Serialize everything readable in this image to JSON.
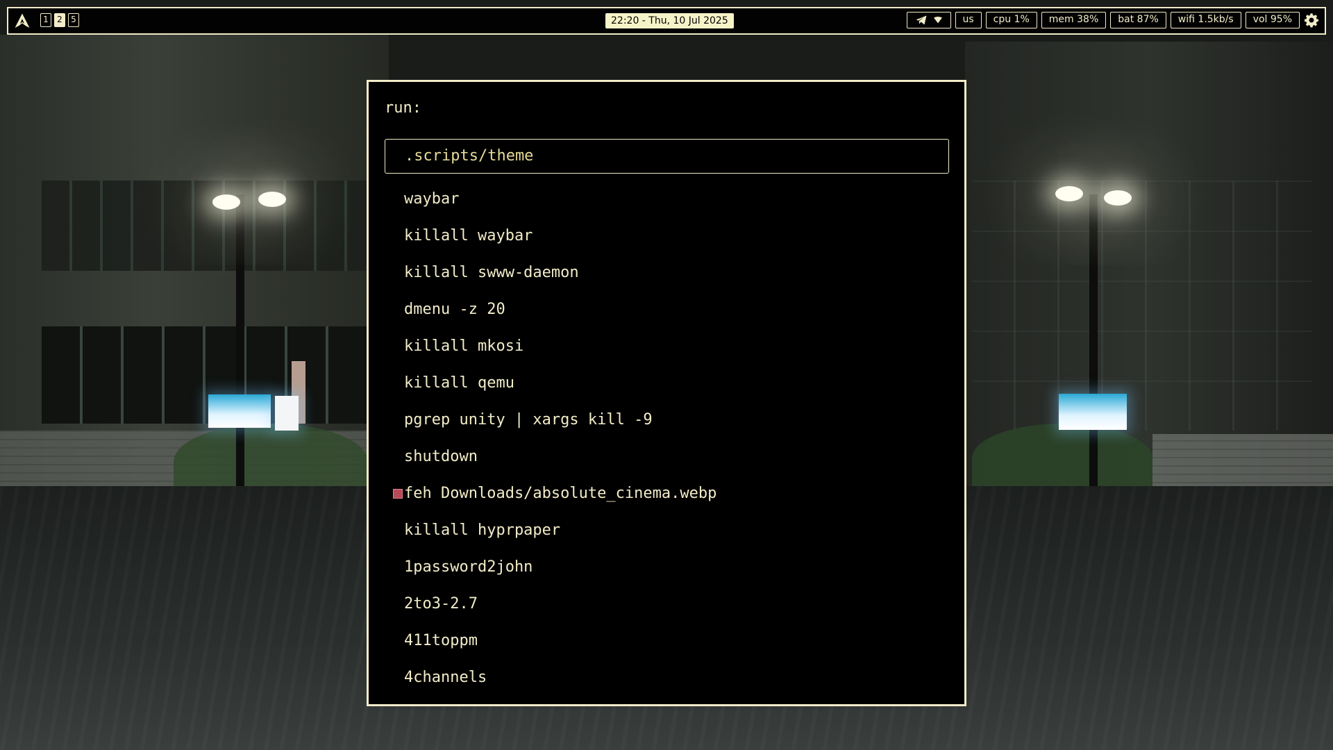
{
  "topbar": {
    "workspaces": [
      {
        "label": "1",
        "active": false
      },
      {
        "label": "2",
        "active": true
      },
      {
        "label": "5",
        "active": false
      }
    ],
    "clock": "22:20 - Thu, 10 Jul 2025",
    "tray_icons": [
      "telegram-icon",
      "wifi-tray-icon"
    ],
    "modules": {
      "keyboard": "us",
      "cpu": "cpu 1%",
      "mem": "mem 38%",
      "bat": "bat 87%",
      "wifi": "wifi 1.5kb/s",
      "vol": "vol 95%"
    },
    "settings_icon": "gear-icon",
    "accent_color": "#f2ecc8",
    "clock_bg_color": "#f7f3c8"
  },
  "launcher": {
    "prompt": "run:",
    "selected": ".scripts/theme",
    "results": [
      "waybar",
      "killall waybar",
      "killall swww-daemon",
      "dmenu -z 20",
      "killall mkosi",
      "killall qemu",
      "pgrep unity | xargs kill -9",
      "shutdown",
      "feh Downloads/absolute_cinema.webp",
      "killall hyprpaper",
      "1password2john",
      "2to3-2.7",
      "411toppm",
      "4channels"
    ],
    "selected_color": "#e7dc9a",
    "marker_color": "#b84a58"
  }
}
